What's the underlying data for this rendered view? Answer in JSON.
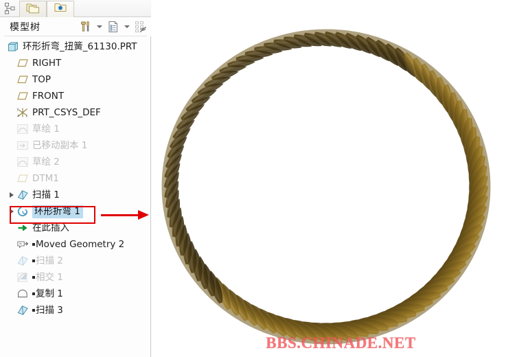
{
  "window": {
    "panel_title": "模型树"
  },
  "tabs": [
    {
      "name": "model-tree-tab",
      "icon": "folder-stack-icon"
    },
    {
      "name": "folder-browser-tab",
      "icon": "folder-star-icon"
    }
  ],
  "header_tools": [
    {
      "name": "settings-tools-button",
      "icon": "hammer-screwdriver-icon"
    },
    {
      "name": "settings-dropdown",
      "icon": "chevron-down-icon"
    },
    {
      "name": "display-list-button",
      "icon": "document-list-icon"
    },
    {
      "name": "display-dropdown",
      "icon": "chevron-down-icon"
    },
    {
      "name": "tree-filter-button",
      "icon": "tree-filter-eye-icon"
    }
  ],
  "tree": {
    "items": [
      {
        "label": "环形折弯_扭簧_61130.PRT",
        "icon": "part-cube-icon",
        "indent": 0,
        "dim": false,
        "expander": false,
        "selected": false,
        "prefix_square": false
      },
      {
        "label": "RIGHT",
        "icon": "datum-plane-icon",
        "indent": 1,
        "dim": false,
        "expander": false,
        "selected": false,
        "prefix_square": false
      },
      {
        "label": "TOP",
        "icon": "datum-plane-icon",
        "indent": 1,
        "dim": false,
        "expander": false,
        "selected": false,
        "prefix_square": false
      },
      {
        "label": "FRONT",
        "icon": "datum-plane-icon",
        "indent": 1,
        "dim": false,
        "expander": false,
        "selected": false,
        "prefix_square": false
      },
      {
        "label": "PRT_CSYS_DEF",
        "icon": "coordinate-system-icon",
        "indent": 1,
        "dim": false,
        "expander": false,
        "selected": false,
        "prefix_square": false
      },
      {
        "label": "草绘 1",
        "icon": "sketch-icon",
        "indent": 1,
        "dim": true,
        "expander": false,
        "selected": false,
        "prefix_square": false
      },
      {
        "label": "已移动副本 1",
        "icon": "moved-copy-icon",
        "indent": 1,
        "dim": true,
        "expander": false,
        "selected": false,
        "prefix_square": false
      },
      {
        "label": "草绘 2",
        "icon": "sketch-icon",
        "indent": 1,
        "dim": true,
        "expander": false,
        "selected": false,
        "prefix_square": false
      },
      {
        "label": "DTM1",
        "icon": "datum-plane-icon",
        "indent": 1,
        "dim": true,
        "expander": false,
        "selected": false,
        "prefix_square": false
      },
      {
        "label": "扫描 1",
        "icon": "sweep-icon",
        "indent": 2,
        "dim": false,
        "expander": true,
        "selected": false,
        "prefix_square": false
      },
      {
        "label": "环形折弯 1",
        "icon": "toroidal-bend-icon",
        "indent": 2,
        "dim": false,
        "expander": true,
        "selected": true,
        "prefix_square": false
      },
      {
        "label": "在此插入",
        "icon": "insert-here-arrow-icon",
        "indent": 1,
        "dim": false,
        "expander": false,
        "selected": false,
        "prefix_square": false
      },
      {
        "label": "Moved Geometry 2",
        "icon": "moved-geometry-icon",
        "indent": 1,
        "dim": false,
        "expander": false,
        "selected": false,
        "prefix_square": true
      },
      {
        "label": "扫描 2",
        "icon": "sweep-icon",
        "indent": 1,
        "dim": true,
        "expander": false,
        "selected": false,
        "prefix_square": true
      },
      {
        "label": "相交 1",
        "icon": "intersect-icon",
        "indent": 1,
        "dim": true,
        "expander": false,
        "selected": false,
        "prefix_square": true
      },
      {
        "label": "复制 1",
        "icon": "copy-icon",
        "indent": 1,
        "dim": false,
        "expander": false,
        "selected": false,
        "prefix_square": true
      },
      {
        "label": "扫描 3",
        "icon": "sweep-icon",
        "indent": 1,
        "dim": false,
        "expander": false,
        "selected": false,
        "prefix_square": true
      }
    ]
  },
  "annotation": {
    "highlight_color": "#e00000",
    "arrow_name": "red-callout-arrow",
    "box_name": "red-callout-box"
  },
  "viewport": {
    "background": "#ffffff",
    "model_name": "toroidal-bend-torsion-spring",
    "model_colors": {
      "dark": "#3f3110",
      "mid": "#6e5518",
      "light": "#c2a04a",
      "highlight": "#d8bb66"
    },
    "blade_count": 96,
    "watermark": "BBS.CHINADE.NET",
    "watermark_color": "#f4595c"
  }
}
